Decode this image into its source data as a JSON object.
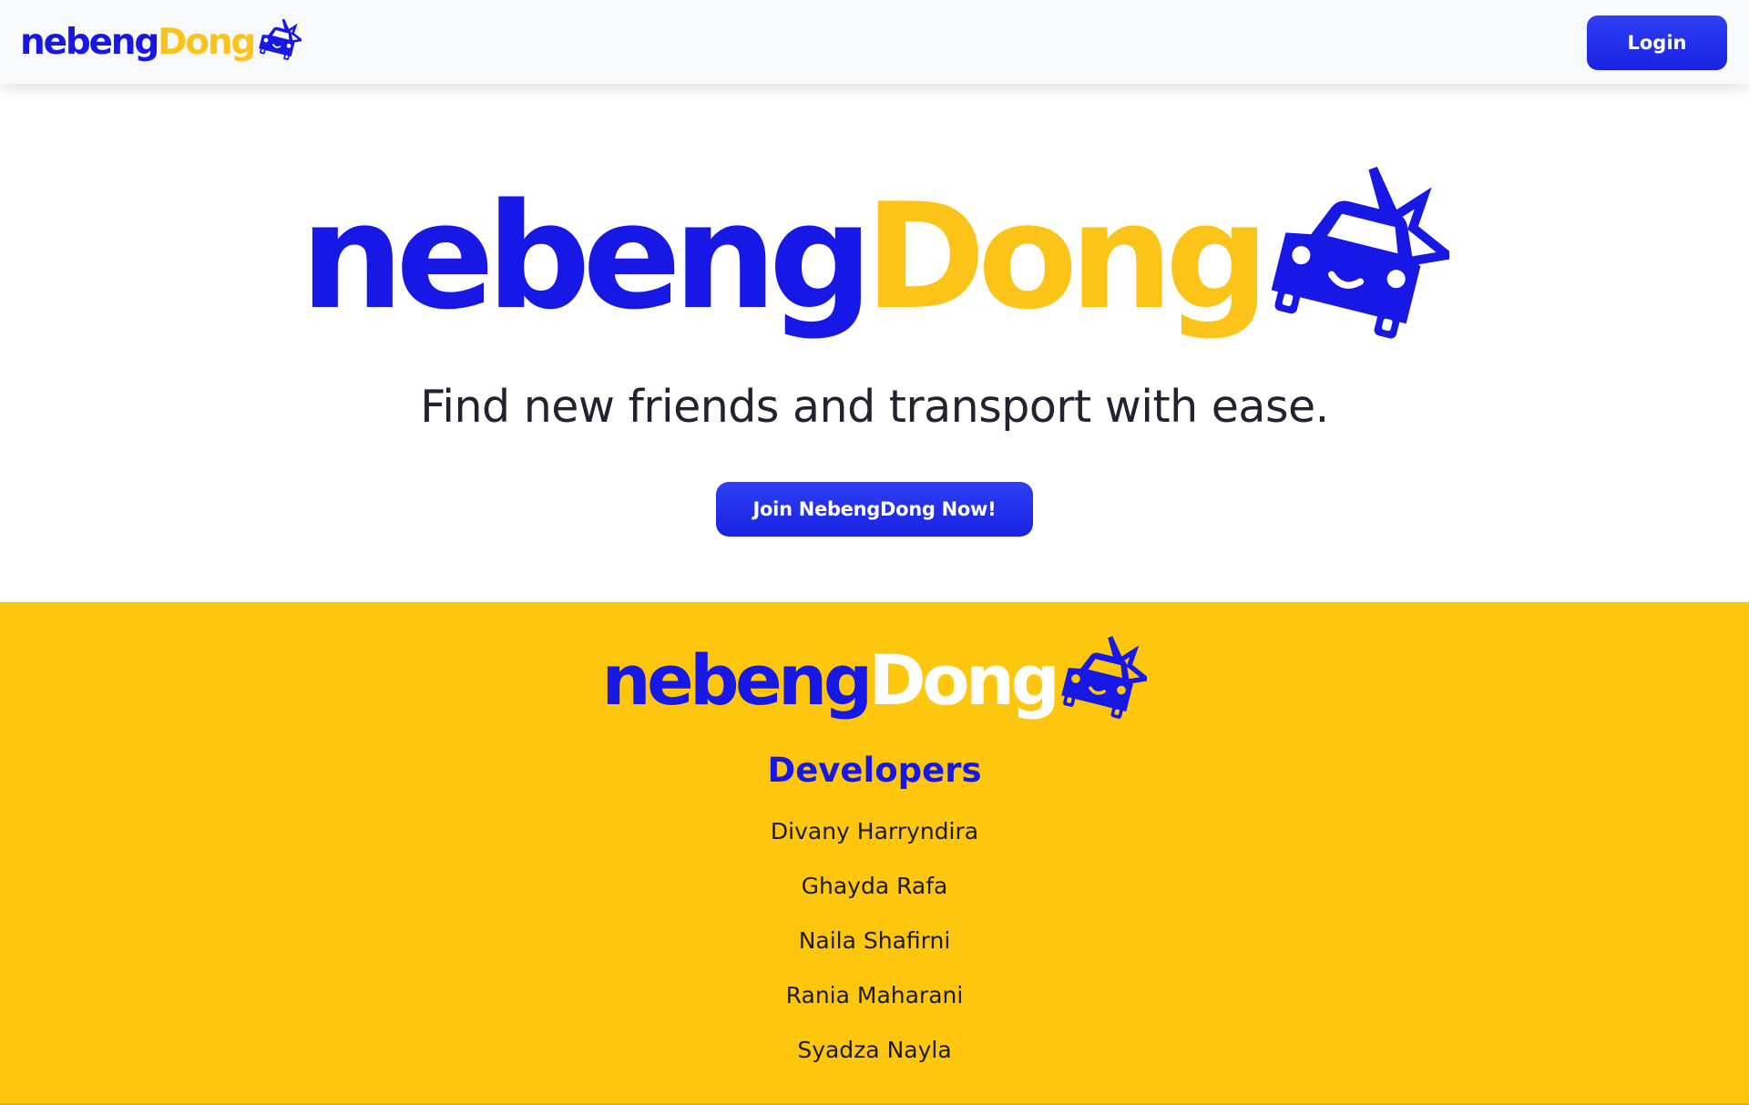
{
  "header": {
    "brand": {
      "part1": "nebeng",
      "part2": "Dong"
    },
    "login_label": "Login"
  },
  "hero": {
    "brand": {
      "part1": "nebeng",
      "part2": "Dong"
    },
    "tagline": "Find new friends and transport with ease.",
    "cta_label": "Join NebengDong Now!"
  },
  "footer": {
    "brand": {
      "part1": "nebeng",
      "part2": "Dong"
    },
    "heading": "Developers",
    "developers": [
      "Divany Harryndira",
      "Ghayda Rafa",
      "Naila Shafirni",
      "Rania Maharani",
      "Syadza Nayla"
    ]
  },
  "colors": {
    "brand_blue": "#1717e6",
    "brand_yellow": "#fcc418",
    "footer_bg": "#fec70d",
    "button_blue": "#1f2be8",
    "topbar_bg": "#f8f9fa"
  },
  "icons": {
    "logo_mark": "car-crash-icon"
  }
}
